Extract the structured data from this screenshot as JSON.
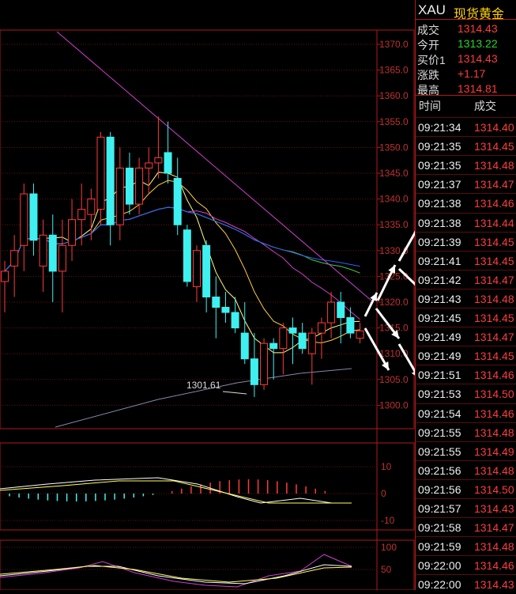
{
  "quote": {
    "symbol": "XAU",
    "name": "现货黄金",
    "rows": [
      {
        "label": "成交",
        "value": "1314.43",
        "color": "#ff3b3b"
      },
      {
        "label": "今开",
        "value": "1313.22",
        "color": "#2bd62b"
      },
      {
        "label": "买价1",
        "value": "1314.43",
        "color": "#ff3b3b"
      },
      {
        "label": "涨跌",
        "value": "+1.17",
        "color": "#ff3b3b"
      },
      {
        "label": "最高",
        "value": "1314.81",
        "color": "#ff3b3b"
      }
    ]
  },
  "ticks": {
    "header_time": "时间",
    "header_price": "成交",
    "rows": [
      {
        "time": "09:21:34",
        "price": "1314.40"
      },
      {
        "time": "09:21:35",
        "price": "1314.45"
      },
      {
        "time": "09:21:35",
        "price": "1314.48"
      },
      {
        "time": "09:21:37",
        "price": "1314.47"
      },
      {
        "time": "09:21:38",
        "price": "1314.46"
      },
      {
        "time": "09:21:38",
        "price": "1314.44"
      },
      {
        "time": "09:21:39",
        "price": "1314.45"
      },
      {
        "time": "09:21:41",
        "price": "1314.45"
      },
      {
        "time": "09:21:42",
        "price": "1314.47"
      },
      {
        "time": "09:21:43",
        "price": "1314.48"
      },
      {
        "time": "09:21:45",
        "price": "1314.45"
      },
      {
        "time": "09:21:49",
        "price": "1314.47"
      },
      {
        "time": "09:21:49",
        "price": "1314.45"
      },
      {
        "time": "09:21:51",
        "price": "1314.46"
      },
      {
        "time": "09:21:53",
        "price": "1314.50"
      },
      {
        "time": "09:21:54",
        "price": "1314.46"
      },
      {
        "time": "09:21:55",
        "price": "1314.48"
      },
      {
        "time": "09:21:55",
        "price": "1314.49"
      },
      {
        "time": "09:21:56",
        "price": "1314.48"
      },
      {
        "time": "09:21:56",
        "price": "1314.50"
      },
      {
        "time": "09:21:57",
        "price": "1314.43"
      },
      {
        "time": "09:21:58",
        "price": "1314.47"
      },
      {
        "time": "09:21:59",
        "price": "1314.48"
      },
      {
        "time": "09:22:00",
        "price": "1314.46"
      },
      {
        "time": "09:22:00",
        "price": "1314.43"
      }
    ]
  },
  "chart": {
    "price_axis": [
      "1370.0",
      "1365.0",
      "1360.0",
      "1355.0",
      "1350.0",
      "1345.0",
      "1340.0",
      "1335.0",
      "1330.0",
      "1325.0",
      "1320.0",
      "1315.0",
      "1310.0",
      "1305.0",
      "1300.0"
    ],
    "low_marker": "1301.61",
    "macd_axis": [
      "10",
      "0",
      "-10"
    ],
    "kdj_axis": [
      "100",
      "50"
    ],
    "colors": {
      "up": "#ff3b3b",
      "down": "#3ff0f0",
      "grid": "#6a1010"
    },
    "candles": [
      {
        "o": 1324,
        "h": 1328,
        "l": 1318,
        "c": 1326
      },
      {
        "o": 1327,
        "h": 1333,
        "l": 1321,
        "c": 1330
      },
      {
        "o": 1331,
        "h": 1343,
        "l": 1326,
        "c": 1341
      },
      {
        "o": 1341,
        "h": 1343,
        "l": 1329,
        "c": 1332
      },
      {
        "o": 1327,
        "h": 1336,
        "l": 1322,
        "c": 1333
      },
      {
        "o": 1333,
        "h": 1337,
        "l": 1320,
        "c": 1326
      },
      {
        "o": 1326,
        "h": 1336,
        "l": 1318,
        "c": 1331
      },
      {
        "o": 1331,
        "h": 1340,
        "l": 1328,
        "c": 1336
      },
      {
        "o": 1336,
        "h": 1343,
        "l": 1331,
        "c": 1338
      },
      {
        "o": 1337,
        "h": 1342,
        "l": 1332,
        "c": 1340
      },
      {
        "o": 1338,
        "h": 1353,
        "l": 1335,
        "c": 1352
      },
      {
        "o": 1352,
        "h": 1353,
        "l": 1331,
        "c": 1335
      },
      {
        "o": 1335,
        "h": 1350,
        "l": 1332,
        "c": 1346
      },
      {
        "o": 1346,
        "h": 1349,
        "l": 1337,
        "c": 1339
      },
      {
        "o": 1339,
        "h": 1348,
        "l": 1337,
        "c": 1346
      },
      {
        "o": 1346,
        "h": 1350,
        "l": 1341,
        "c": 1347
      },
      {
        "o": 1347,
        "h": 1356,
        "l": 1344,
        "c": 1348
      },
      {
        "o": 1349,
        "h": 1355,
        "l": 1343,
        "c": 1345
      },
      {
        "o": 1344,
        "h": 1348,
        "l": 1333,
        "c": 1335
      },
      {
        "o": 1334,
        "h": 1335,
        "l": 1323,
        "c": 1324
      },
      {
        "o": 1323,
        "h": 1331,
        "l": 1320,
        "c": 1330
      },
      {
        "o": 1331,
        "h": 1332,
        "l": 1318,
        "c": 1321
      },
      {
        "o": 1321,
        "h": 1325,
        "l": 1313,
        "c": 1319
      },
      {
        "o": 1319,
        "h": 1322,
        "l": 1316,
        "c": 1318
      },
      {
        "o": 1318,
        "h": 1321,
        "l": 1314,
        "c": 1315
      },
      {
        "o": 1314,
        "h": 1320,
        "l": 1308,
        "c": 1309
      },
      {
        "o": 1309,
        "h": 1314,
        "l": 1301.61,
        "c": 1304
      },
      {
        "o": 1304,
        "h": 1313,
        "l": 1303,
        "c": 1312
      },
      {
        "o": 1312,
        "h": 1313,
        "l": 1305,
        "c": 1311
      },
      {
        "o": 1311,
        "h": 1316,
        "l": 1306,
        "c": 1315
      },
      {
        "o": 1315,
        "h": 1317,
        "l": 1308,
        "c": 1314
      },
      {
        "o": 1314,
        "h": 1316,
        "l": 1310,
        "c": 1311
      },
      {
        "o": 1310,
        "h": 1315,
        "l": 1304,
        "c": 1314
      },
      {
        "o": 1314,
        "h": 1317,
        "l": 1309,
        "c": 1316
      },
      {
        "o": 1316,
        "h": 1322,
        "l": 1313,
        "c": 1320
      },
      {
        "o": 1320,
        "h": 1322,
        "l": 1312,
        "c": 1317
      },
      {
        "o": 1317,
        "h": 1319,
        "l": 1313,
        "c": 1314
      },
      {
        "o": 1313,
        "h": 1316,
        "l": 1312,
        "c": 1314.43
      }
    ]
  }
}
